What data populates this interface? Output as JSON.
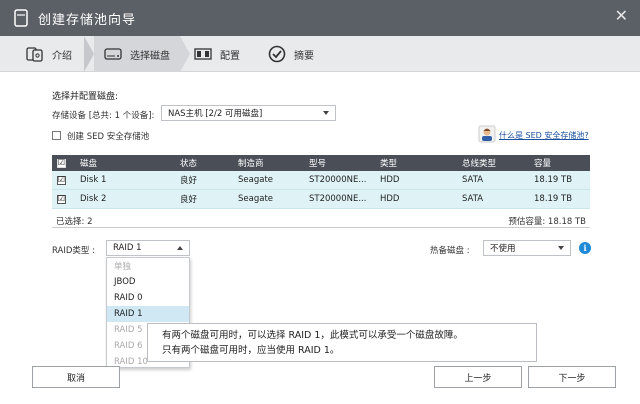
{
  "window": {
    "title": "创建存储池向导"
  },
  "steps": [
    {
      "label": "介绍",
      "icon": "disks-icon"
    },
    {
      "label": "选择磁盘",
      "icon": "drive-icon"
    },
    {
      "label": "配置",
      "icon": "raid-config-icon"
    },
    {
      "label": "摘要",
      "icon": "check-circle-icon"
    }
  ],
  "active_step": 1,
  "form": {
    "section_title": "选择并配置磁盘:",
    "storage_device_label": "存储设备 [总共: 1 个设备]:",
    "storage_device_value": "NAS主机 [2/2 可用磁盘]",
    "sed_checkbox_label": "创建 SED 安全存储池",
    "sed_checked": false,
    "sed_help_link": "什么是 SED 安全存储池?"
  },
  "disk_table": {
    "headers": [
      "磁盘",
      "状态",
      "制造商",
      "型号",
      "类型",
      "总线类型",
      "容量"
    ],
    "rows": [
      {
        "checked": true,
        "disk": "Disk 1",
        "status": "良好",
        "vendor": "Seagate",
        "model": "ST20000NE...",
        "type": "HDD",
        "bus": "SATA",
        "capacity": "18.19 TB"
      },
      {
        "checked": true,
        "disk": "Disk 2",
        "status": "良好",
        "vendor": "Seagate",
        "model": "ST20000NE...",
        "type": "HDD",
        "bus": "SATA",
        "capacity": "18.19 TB"
      }
    ],
    "selected_count": "已选择: 2",
    "estimated_capacity": "预估容量: 18.18 TB"
  },
  "raid": {
    "label": "RAID类型 :",
    "value": "RAID 1",
    "options": [
      {
        "label": "单独",
        "disabled": true
      },
      {
        "label": "JBOD",
        "disabled": false
      },
      {
        "label": "RAID 0",
        "disabled": false
      },
      {
        "label": "RAID 1",
        "disabled": false,
        "selected": true
      },
      {
        "label": "RAID 5",
        "disabled": true
      },
      {
        "label": "RAID 6",
        "disabled": true
      },
      {
        "label": "RAID 10",
        "disabled": true
      }
    ]
  },
  "hot_spare": {
    "label": "热备磁盘 :",
    "value": "不使用"
  },
  "tooltip": {
    "line1": "有两个磁盘可用时，可以选择 RAID 1，此模式可以承受一个磁盘故障。",
    "line2": "只有两个磁盘可用时，应当使用 RAID 1。"
  },
  "buttons": {
    "cancel": "取消",
    "back": "上一步",
    "next": "下一步"
  },
  "colors": {
    "titlebar": "#5b5f66",
    "table_header": "#4a4f57",
    "row_bg": "#dff3f6",
    "link": "#1a4fa0",
    "info": "#1f8ad6"
  }
}
